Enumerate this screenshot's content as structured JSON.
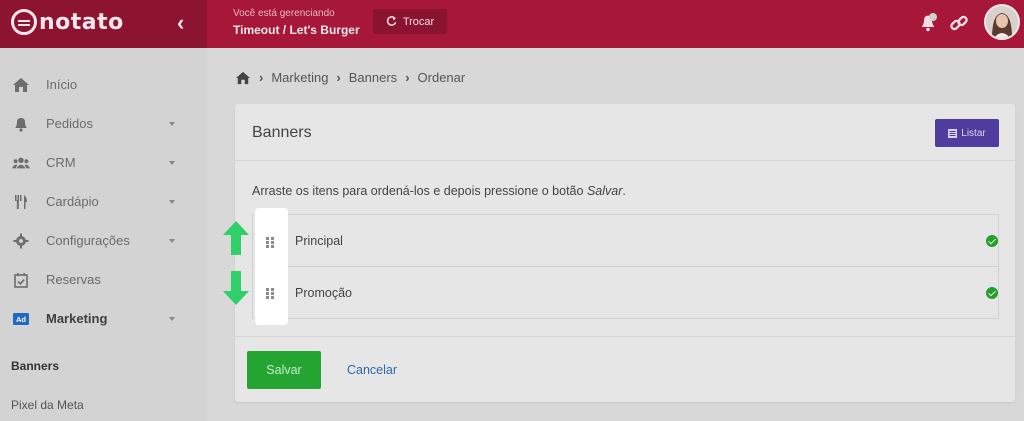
{
  "header": {
    "logo_text": "notato",
    "managing_label": "Você está gerenciando",
    "managing_name": "Timeout / Let's Burger",
    "switch_label": "Trocar",
    "brand_color": "#a6173a"
  },
  "sidebar": {
    "items": [
      {
        "label": "Início",
        "icon": "home-icon"
      },
      {
        "label": "Pedidos",
        "icon": "bell-icon"
      },
      {
        "label": "CRM",
        "icon": "users-icon"
      },
      {
        "label": "Cardápio",
        "icon": "utensils-icon"
      },
      {
        "label": "Configurações",
        "icon": "gear-icon"
      },
      {
        "label": "Reservas",
        "icon": "calendar-check-icon"
      },
      {
        "label": "Marketing",
        "icon": "ad-icon"
      }
    ],
    "ad_badge": "Ad",
    "sub_items": [
      "Banners",
      "Pixel da Meta"
    ]
  },
  "breadcrumb": [
    "Marketing",
    "Banners",
    "Ordenar"
  ],
  "card": {
    "title": "Banners",
    "list_button": "Listar",
    "instructions_prefix": "Arraste os itens para ordená-los e depois pressione o botão",
    "instructions_em": "Salvar",
    "instructions_suffix": ".",
    "rows": [
      "Principal",
      "Promoção"
    ],
    "save_button": "Salvar",
    "cancel_link": "Cancelar"
  },
  "colors": {
    "accent_purple": "#4e3c9e",
    "save_green": "#24a531",
    "arrow_green": "#2fcf6a",
    "link_blue": "#2b6aa7"
  }
}
